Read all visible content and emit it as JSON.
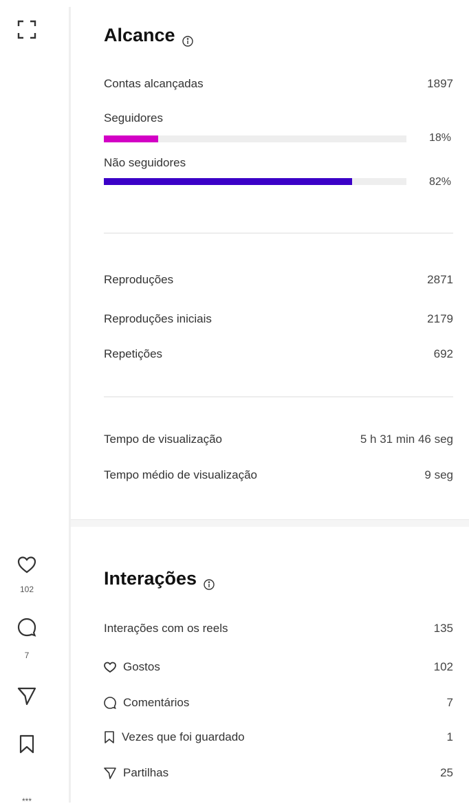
{
  "rail": {
    "expand_icon": "expand-icon",
    "likes_count": "102",
    "comments_count": "7",
    "more_count": "***"
  },
  "reach": {
    "title": "Alcance",
    "accounts_label": "Contas alcançadas",
    "accounts_value": "1897",
    "followers_label": "Seguidores",
    "followers_pct": "18%",
    "followers_fraction": 0.18,
    "non_followers_label": "Não seguidores",
    "non_followers_pct": "82%",
    "non_followers_fraction": 0.82,
    "followers_color": "#d300c5",
    "non_followers_color": "#3b00c7"
  },
  "plays": {
    "plays_label": "Reproduções",
    "plays_value": "2871",
    "initial_label": "Reproduções iniciais",
    "initial_value": "2179",
    "replays_label": "Repetições",
    "replays_value": "692"
  },
  "watch": {
    "time_label": "Tempo de visualização",
    "time_value": "5 h 31 min 46 seg",
    "avg_label": "Tempo médio de visualização",
    "avg_value": "9 seg"
  },
  "interactions": {
    "title": "Interações",
    "reels_label": "Interações com os reels",
    "reels_value": "135",
    "likes_label": "Gostos",
    "likes_value": "102",
    "comments_label": "Comentários",
    "comments_value": "7",
    "saves_label": "Vezes que foi guardado",
    "saves_value": "1",
    "shares_label": "Partilhas",
    "shares_value": "25"
  }
}
